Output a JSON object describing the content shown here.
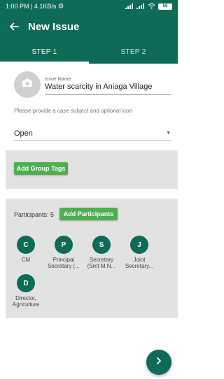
{
  "status_bar": {
    "time_speed": "1:00 PM | 4.1KB/s",
    "battery": "56"
  },
  "app_bar": {
    "title": "New Issue"
  },
  "tabs": [
    {
      "label": "STEP 1",
      "active": true
    },
    {
      "label": "STEP 2",
      "active": false
    }
  ],
  "issue": {
    "name_label": "Issue Name",
    "name_value": "Water scarcity in Aniaga Village",
    "hint": "Please provide a case subject and optional icon"
  },
  "status_select": {
    "value": "Open"
  },
  "group_tags": {
    "button_label": "Add Group Tags"
  },
  "participants": {
    "label": "Participants: 5",
    "add_button_label": "Add Participants",
    "items": [
      {
        "initial": "C",
        "name": "CM"
      },
      {
        "initial": "P",
        "name": "Principal Secretary (..."
      },
      {
        "initial": "S",
        "name": "Secretary (Smt M.N..."
      },
      {
        "initial": "J",
        "name": "Joint Secretary..."
      },
      {
        "initial": "D",
        "name": "Director, Agriculture"
      }
    ]
  },
  "colors": {
    "primary": "#0e6b57",
    "accent_button": "#4caf50",
    "panel_bg": "#e2e2e2"
  }
}
